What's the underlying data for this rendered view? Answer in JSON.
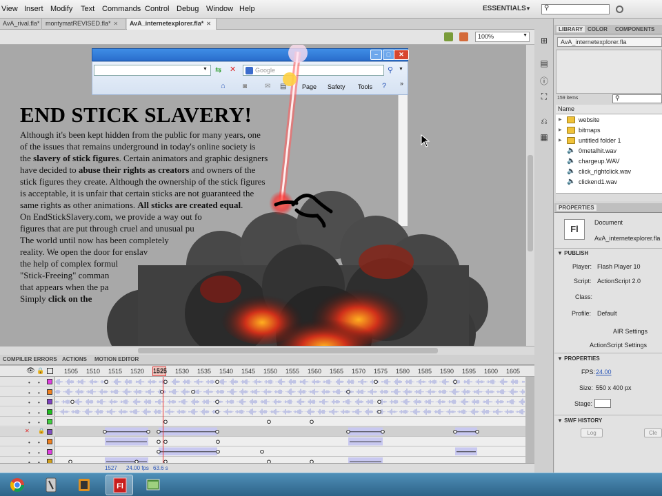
{
  "menubar": {
    "items": [
      "View",
      "Insert",
      "Modify",
      "Text",
      "Commands",
      "Control",
      "Debug",
      "Window",
      "Help"
    ],
    "workspace": "ESSENTIALS"
  },
  "doc_tabs": [
    {
      "label": "AvA_rival.fla*",
      "active": false
    },
    {
      "label": "montymatREVISED.fla*",
      "active": false
    },
    {
      "label": "AvA_internetexplorer.fla*",
      "active": true
    }
  ],
  "editbar": {
    "zoom": "100%"
  },
  "browser": {
    "search_placeholder": "Google",
    "commands": [
      "Page",
      "Safety",
      "Tools"
    ]
  },
  "webpage": {
    "headline": "END STICK SLAVERY!",
    "paragraphs": [
      [
        "Although it's been kept hidden from the public for many years, one of the issues that remains underground in today's online society is the ",
        {
          "b": "slavery of stick figures"
        },
        ".  Certain animators and graphic designers have decided to ",
        {
          "b": "abuse their rights as creators"
        },
        " and owners of the stick figures they create.  Although the ownership of the stick figures is acceptable, it is unfair that certain sticks are not guaranteed the same rights as other animations.  ",
        {
          "b": "All sticks are created equal"
        },
        "."
      ],
      [
        "On EndStickSlavery.com, we provide a way out fo"
      ],
      [
        "figures that are put through cruel and unusual pu"
      ],
      [
        "The world until now has been completely"
      ],
      [
        "reality.  We open the door for enslav"
      ],
      [
        "the help of complex formul"
      ],
      [
        "\"Stick-Freeing\" comman"
      ],
      [
        "that appears when the pa"
      ],
      [
        "Simply ",
        {
          "b": "click on the"
        }
      ]
    ]
  },
  "timeline": {
    "tabs": [
      "COMPILER ERRORS",
      "ACTIONS",
      "MOTION EDITOR"
    ],
    "ruler": [
      "1505",
      "1510",
      "1515",
      "1520",
      "1525",
      "1530",
      "1535",
      "1540",
      "1545",
      "1550",
      "1555",
      "1560",
      "1565",
      "1570",
      "1575",
      "1580",
      "1585",
      "1590",
      "1595",
      "1600",
      "1605"
    ],
    "current_frame_label": "1525",
    "status": {
      "frame": "1527",
      "fps": "24.00 fps",
      "time": "63.6 s"
    },
    "layer_colors": [
      "#e040e0",
      "#f08020",
      "#8040c0",
      "#20c020",
      "#40d040",
      "#8050c0",
      "#f08020",
      "#e040e0",
      "#d0a020"
    ]
  },
  "library": {
    "tabs": [
      "LIBRARY",
      "COLOR",
      "COMPONENTS"
    ],
    "document": "AvA_internetexplorer.fla",
    "item_count": "159 items",
    "column": "Name",
    "items": [
      {
        "name": "website",
        "kind": "folder"
      },
      {
        "name": "bitmaps",
        "kind": "folder"
      },
      {
        "name": "untitled folder 1",
        "kind": "folder"
      },
      {
        "name": "0metalhit.wav",
        "kind": "sound"
      },
      {
        "name": "chargeup.WAV",
        "kind": "sound"
      },
      {
        "name": "click_rightclick.wav",
        "kind": "sound"
      },
      {
        "name": "clickend1.wav",
        "kind": "sound"
      }
    ]
  },
  "properties": {
    "tab": "PROPERTIES",
    "doc_type": "Document",
    "doc_icon": "Fl",
    "doc_name": "AvA_internetexplorer.fla",
    "publish_header": "PUBLISH",
    "player_label": "Player:",
    "player": "Flash Player 10",
    "script_label": "Script:",
    "script": "ActionScript 2.0",
    "class_label": "Class:",
    "profile_label": "Profile:",
    "profile": "Default",
    "air_settings": "AIR Settings",
    "as_settings": "ActionScript Settings",
    "props_header": "PROPERTIES",
    "fps_label": "FPS:",
    "fps": "24.00",
    "size_label": "Size:",
    "size": "550 x 400 px",
    "stage_label": "Stage:",
    "swf_header": "SWF HISTORY",
    "log_btn": "Log",
    "clear_btn": "Cle"
  },
  "taskbar": {
    "apps": [
      "chrome-icon",
      "pen-tablet-icon",
      "media-player-icon",
      "flash-icon",
      "window-icon"
    ]
  }
}
